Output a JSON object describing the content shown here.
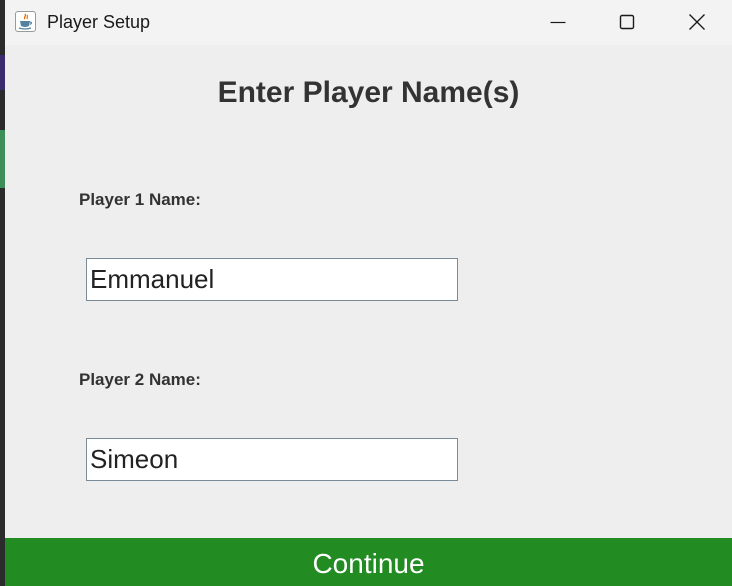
{
  "window": {
    "title": "Player Setup",
    "app_icon": "java-cup-icon",
    "controls": [
      "minimize-icon",
      "maximize-icon",
      "close-icon"
    ]
  },
  "form": {
    "heading": "Enter Player Name(s)",
    "player1": {
      "label": "Player 1 Name:",
      "value": "Emmanuel"
    },
    "player2": {
      "label": "Player 2 Name:",
      "value": "Simeon"
    },
    "continue_label": "Continue"
  },
  "colors": {
    "continue_bg": "#228B22",
    "panel_bg": "#EEEEEE",
    "titlebar_bg": "#F3F3F3",
    "text": "#333333"
  }
}
